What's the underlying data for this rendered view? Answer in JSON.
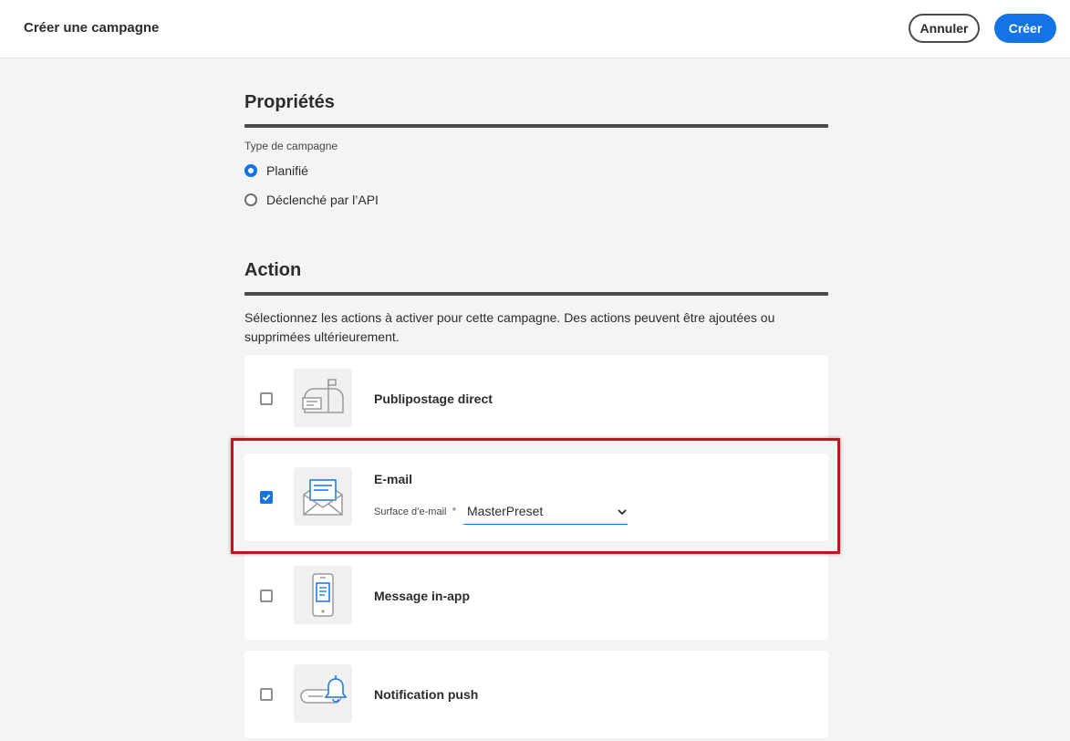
{
  "header": {
    "title": "Créer une campagne",
    "cancel_label": "Annuler",
    "create_label": "Créer"
  },
  "properties": {
    "heading": "Propriétés",
    "campaign_type_label": "Type de campagne",
    "options": [
      {
        "label": "Planifié",
        "selected": true
      },
      {
        "label": "Déclenché par l’API",
        "selected": false
      }
    ]
  },
  "action": {
    "heading": "Action",
    "description": "Sélectionnez les actions à activer pour cette campagne. Des actions peuvent être ajoutées ou supprimées ultérieurement.",
    "items": [
      {
        "label": "Publipostage direct",
        "checked": false,
        "icon": "mailbox-icon"
      },
      {
        "label": "E-mail",
        "checked": true,
        "icon": "envelope-icon",
        "surface_label": "Surface d’e-mail",
        "required_mark": "*",
        "surface_value": "MasterPreset"
      },
      {
        "label": "Message in-app",
        "checked": false,
        "icon": "mobile-message-icon"
      },
      {
        "label": "Notification push",
        "checked": false,
        "icon": "bell-notification-icon"
      }
    ]
  },
  "colors": {
    "accent": "#1473e6",
    "highlight": "#b51b1b"
  }
}
